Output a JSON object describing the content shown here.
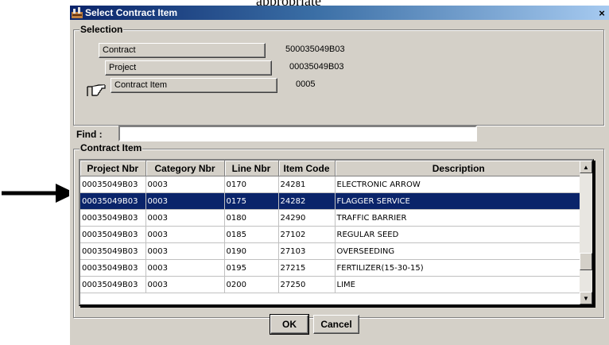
{
  "page": {
    "cut_heading": "appropriate"
  },
  "window": {
    "title": "Select Contract Item",
    "close_symbol": "×"
  },
  "selection": {
    "label": "Selection",
    "contract_label": "Contract",
    "contract_value": "500035049B03",
    "project_label": "Project",
    "project_value": "00035049B03",
    "contract_item_label": "Contract Item",
    "contract_item_value": "0005"
  },
  "find": {
    "label": "Find :",
    "value": ""
  },
  "contract_item": {
    "label": "Contract Item",
    "columns": [
      "Project Nbr",
      "Category Nbr",
      "Line Nbr",
      "Item Code",
      "Description"
    ],
    "rows": [
      {
        "project": "00035049B03",
        "category": "0003",
        "line": "0170",
        "item_code": "24281",
        "description": "ELECTRONIC ARROW"
      },
      {
        "project": "00035049B03",
        "category": "0003",
        "line": "0175",
        "item_code": "24282",
        "description": "FLAGGER SERVICE"
      },
      {
        "project": "00035049B03",
        "category": "0003",
        "line": "0180",
        "item_code": "24290",
        "description": "TRAFFIC BARRIER"
      },
      {
        "project": "00035049B03",
        "category": "0003",
        "line": "0185",
        "item_code": "27102",
        "description": "REGULAR SEED"
      },
      {
        "project": "00035049B03",
        "category": "0003",
        "line": "0190",
        "item_code": "27103",
        "description": "OVERSEEDING"
      },
      {
        "project": "00035049B03",
        "category": "0003",
        "line": "0195",
        "item_code": "27215",
        "description": "FERTILIZER(15-30-15)"
      },
      {
        "project": "00035049B03",
        "category": "0003",
        "line": "0200",
        "item_code": "27250",
        "description": "LIME"
      }
    ],
    "selected_row": 1
  },
  "buttons": {
    "ok": "OK",
    "cancel": "Cancel"
  },
  "icons": {
    "app": "app-icon",
    "close": "close-icon",
    "pointer": "pointing-hand-icon",
    "annotation": "arrow-right-icon",
    "scroll_up": "scroll-up-icon",
    "scroll_down": "scroll-down-icon"
  },
  "colors": {
    "title_bar": "#0a246a",
    "selection_highlight": "#0a246a",
    "window_face": "#d4d0c8"
  }
}
